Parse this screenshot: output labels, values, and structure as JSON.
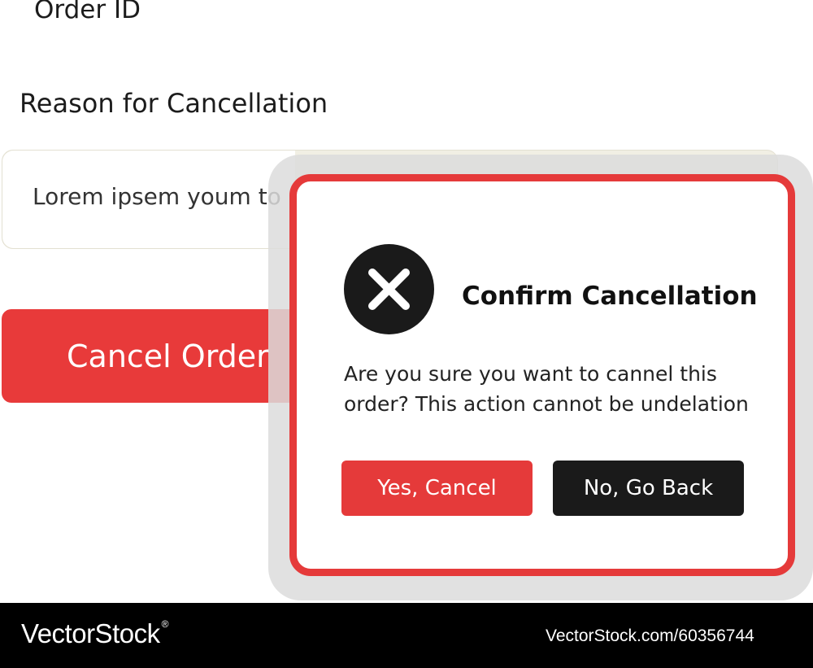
{
  "form": {
    "order_id_label": "Order ID",
    "reason_label": "Reason for Cancellation",
    "reason_value": "Lorem ipsem youm to",
    "cancel_button_label": "Cancel Order"
  },
  "dialog": {
    "title": "Confirm Cancellation",
    "message": "Are you sure you want to cannel this order? This action cannot be undelation",
    "confirm_label": "Yes, Cancel",
    "back_label": "No, Go Back",
    "icon": "close-circle-icon"
  },
  "footer": {
    "brand": "VectorStock",
    "registered_mark": "®",
    "image_ref": "VectorStock.com/60356744"
  },
  "colors": {
    "accent_red": "#e53a3a",
    "dark": "#1a1a1a",
    "input_background": "#f1efe4"
  }
}
